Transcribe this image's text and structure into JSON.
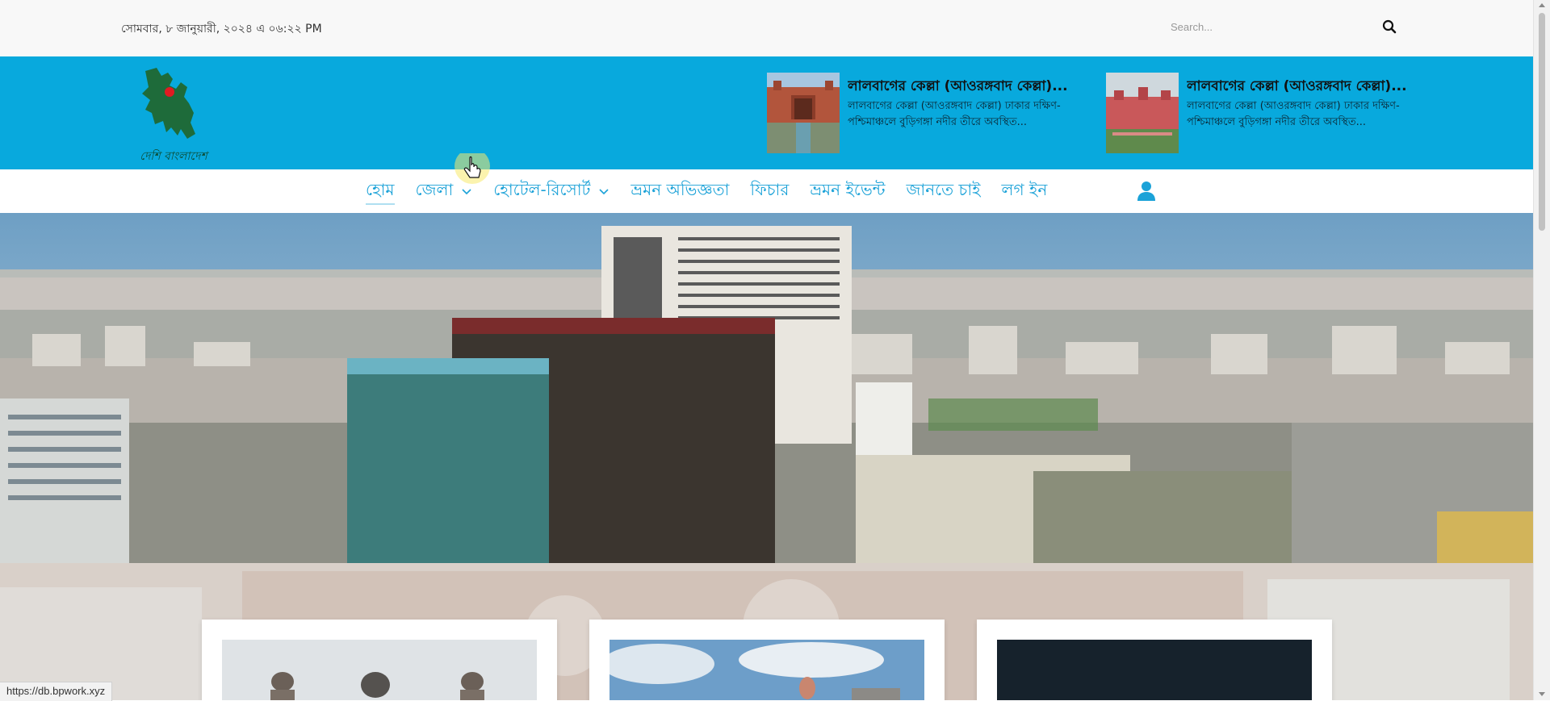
{
  "topbar": {
    "date_text": "সোমবার, ৮ জানুয়ারী, ২০২৪ এ ০৬:২২ PM",
    "search_placeholder": "Search...",
    "search_icon": "search-icon"
  },
  "header": {
    "logo_text": "দেশি বাংলাদেশ",
    "news": [
      {
        "title": "লালবাগের কেল্লা (আওরঙ্গবাদ কেল্লা)...",
        "desc": "লালবাগের কেল্লা (আওরঙ্গবাদ কেল্লা) ঢাকার দক্ষিণ-পশ্চিমাঞ্চলে বুড়িগঙ্গা নদীর তীরে অবস্থিত..."
      },
      {
        "title": "লালবাগের কেল্লা (আওরঙ্গবাদ কেল্লা)...",
        "desc": "লালবাগের কেল্লা (আওরঙ্গবাদ কেল্লা) ঢাকার দক্ষিণ-পশ্চিমাঞ্চলে বুড়িগঙ্গা নদীর তীরে অবস্থিত..."
      }
    ]
  },
  "nav": {
    "items": [
      {
        "label": "হোম",
        "active": true,
        "dropdown": false
      },
      {
        "label": "জেলা",
        "active": false,
        "dropdown": true
      },
      {
        "label": "হোটেল-রিসোর্ট",
        "active": false,
        "dropdown": true
      },
      {
        "label": "ভ্রমন অভিজ্ঞতা",
        "active": false,
        "dropdown": false
      },
      {
        "label": "ফিচার",
        "active": false,
        "dropdown": false
      },
      {
        "label": "ভ্রমন ইভেন্ট",
        "active": false,
        "dropdown": false
      },
      {
        "label": "জানতে চাই",
        "active": false,
        "dropdown": false
      },
      {
        "label": "লগ ইন",
        "active": false,
        "dropdown": false
      }
    ],
    "user_icon": "user-icon"
  },
  "status_bar": {
    "url": "https://db.bpwork.xyz"
  },
  "colors": {
    "header_bg": "#08a9dd",
    "nav_text": "#1ba2d8"
  }
}
